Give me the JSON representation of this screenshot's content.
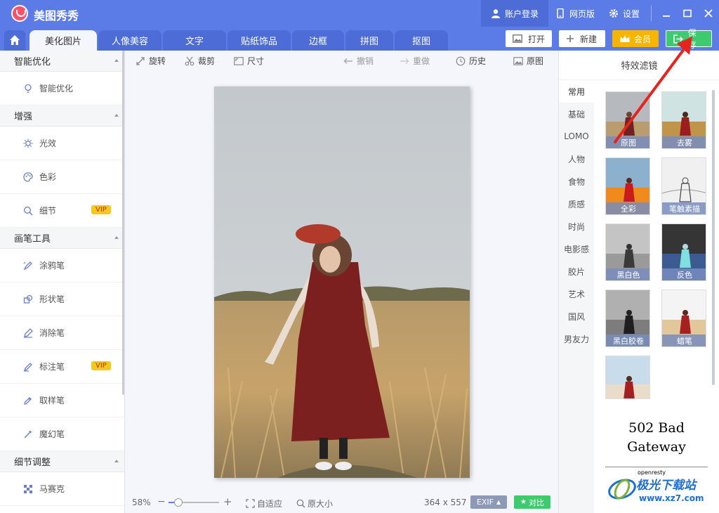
{
  "app": {
    "title": "美图秀秀",
    "login": "账户登录",
    "web": "网页版",
    "settings": "设置"
  },
  "tabs": [
    {
      "label": "美化图片",
      "active": true
    },
    {
      "label": "人像美容",
      "active": false
    },
    {
      "label": "文字",
      "active": false
    },
    {
      "label": "贴纸饰品",
      "active": false
    },
    {
      "label": "边框",
      "active": false
    },
    {
      "label": "拼图",
      "active": false
    },
    {
      "label": "抠图",
      "active": false
    }
  ],
  "actions": {
    "open": "打开",
    "new": "新建",
    "vip": "会员",
    "save": "保存"
  },
  "sidebar": {
    "sections": [
      {
        "title": "智能优化",
        "items": [
          {
            "label": "智能优化",
            "icon": "bulb-icon",
            "vip": false
          }
        ]
      },
      {
        "title": "增强",
        "items": [
          {
            "label": "光效",
            "icon": "sun-icon",
            "vip": false
          },
          {
            "label": "色彩",
            "icon": "palette-icon",
            "vip": false
          },
          {
            "label": "细节",
            "icon": "magnifier-icon",
            "vip": true
          }
        ]
      },
      {
        "title": "画笔工具",
        "items": [
          {
            "label": "涂鸦笔",
            "icon": "doodle-icon",
            "vip": false
          },
          {
            "label": "形状笔",
            "icon": "shape-icon",
            "vip": false
          },
          {
            "label": "消除笔",
            "icon": "eraser-icon",
            "vip": false
          },
          {
            "label": "标注笔",
            "icon": "marker-icon",
            "vip": true
          },
          {
            "label": "取样笔",
            "icon": "dropper-icon",
            "vip": false
          },
          {
            "label": "魔幻笔",
            "icon": "magic-wand-icon",
            "vip": false
          }
        ]
      },
      {
        "title": "细节调整",
        "items": [
          {
            "label": "马赛克",
            "icon": "mosaic-icon",
            "vip": false
          }
        ]
      }
    ],
    "vip_label": "VIP"
  },
  "toolbar": {
    "rotate": "旋转",
    "crop": "裁剪",
    "size": "尺寸",
    "undo": "撤销",
    "redo": "重做",
    "history": "历史",
    "original": "原图"
  },
  "statusbar": {
    "zoom": "58%",
    "zoom_fraction": 0.2,
    "fit": "自适应",
    "actual": "原大小",
    "dimensions": "364 x 557",
    "exif": "EXIF",
    "compare": "对比"
  },
  "filters": {
    "title": "特效滤镜",
    "categories": [
      "常用",
      "基础",
      "LOMO",
      "人物",
      "食物",
      "质感",
      "时尚",
      "电影感",
      "胶片",
      "艺术",
      "国风",
      "男友力"
    ],
    "active_category": "常用",
    "items": [
      {
        "label": "原图"
      },
      {
        "label": "去雾"
      },
      {
        "label": "全彩"
      },
      {
        "label": "笔触素描"
      },
      {
        "label": "黑白色"
      },
      {
        "label": "反色"
      },
      {
        "label": "黑白胶卷"
      },
      {
        "label": "蜡笔"
      },
      {
        "label": ""
      }
    ],
    "error_title": "502 Bad Gateway",
    "error_footer": "openresty"
  },
  "watermark": {
    "name": "极光下载站",
    "url": "www.xz7.com"
  },
  "colors": {
    "brand": "#5b7be6",
    "save": "#3ecb6f",
    "vip": "#f7b500",
    "annotation_arrow": "#e8231f"
  }
}
